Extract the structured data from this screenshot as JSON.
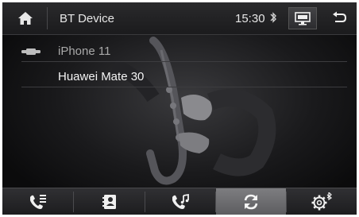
{
  "header": {
    "title": "BT Device",
    "time": "15:30"
  },
  "devices": [
    {
      "name": "iPhone 11",
      "connected": true,
      "icon": "phone-connected-icon"
    },
    {
      "name": "Huawei Mate 30",
      "connected": false,
      "icon": ""
    }
  ],
  "bottom_nav": [
    {
      "name": "call-log",
      "icon": "phone-list-icon",
      "active": false
    },
    {
      "name": "contacts",
      "icon": "contacts-icon",
      "active": false
    },
    {
      "name": "bt-music",
      "icon": "phone-music-icon",
      "active": false
    },
    {
      "name": "sync",
      "icon": "sync-icon",
      "active": true
    },
    {
      "name": "bt-settings",
      "icon": "gear-bluetooth-icon",
      "active": false
    }
  ],
  "colors": {
    "accent_active": "#6b6b6e",
    "text": "#f4f4f4",
    "text_dim": "#a9a9a9",
    "background": "#0e0e10"
  }
}
